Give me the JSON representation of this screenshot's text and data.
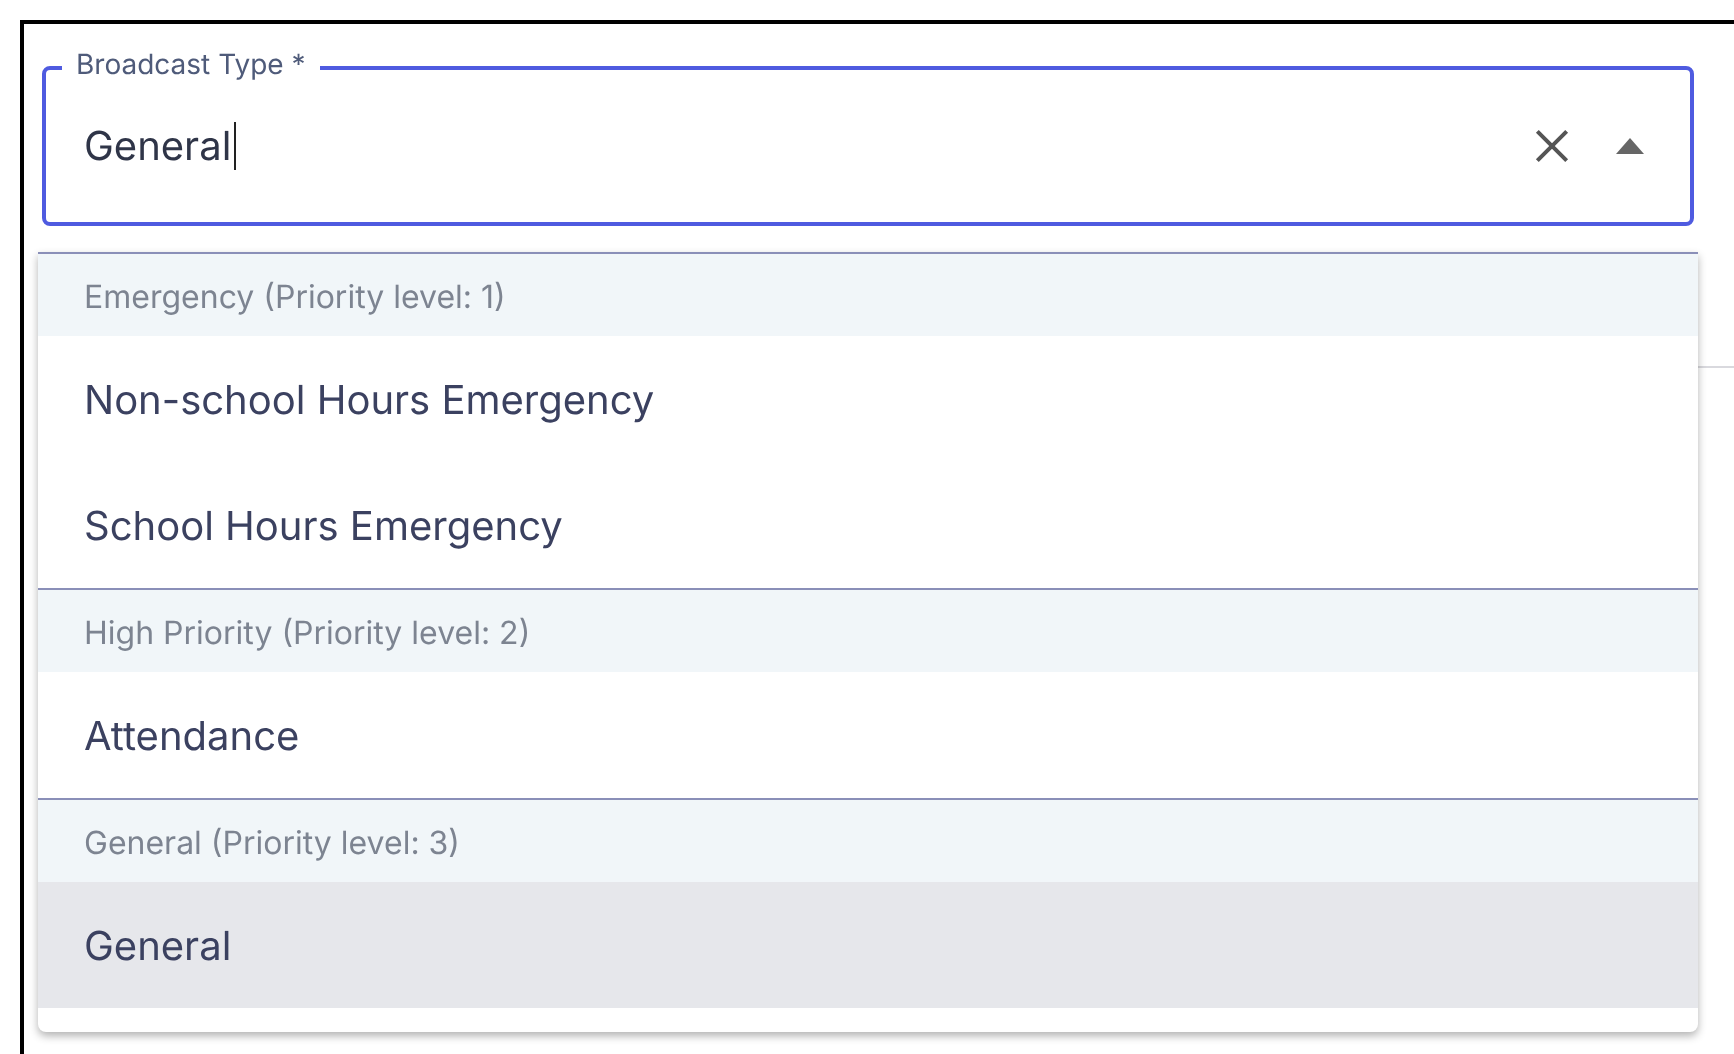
{
  "field": {
    "label": "Broadcast Type *",
    "value": "General",
    "focused": true
  },
  "menu": {
    "groups": [
      {
        "header": "Emergency (Priority level: 1)",
        "options": [
          {
            "label": "Non-school Hours Emergency",
            "selected": false
          },
          {
            "label": "School Hours Emergency",
            "selected": false
          }
        ]
      },
      {
        "header": "High Priority (Priority level: 2)",
        "options": [
          {
            "label": "Attendance",
            "selected": false
          }
        ]
      },
      {
        "header": "General (Priority level: 3)",
        "options": [
          {
            "label": "General",
            "selected": true
          }
        ]
      }
    ]
  }
}
